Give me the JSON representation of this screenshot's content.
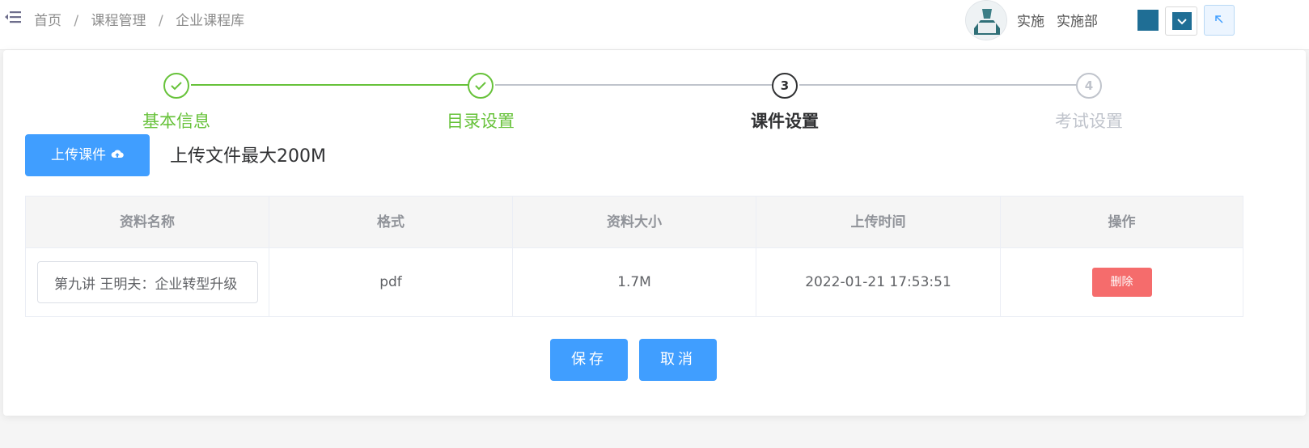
{
  "breadcrumb": {
    "items": [
      "首页",
      "课程管理",
      "企业课程库"
    ],
    "separator": "/"
  },
  "user": {
    "name": "实施",
    "department": "实施部"
  },
  "icons": {
    "menu": "menu-fold-icon",
    "avatar": "user-avatar",
    "fullscreen": "arrow-up-left-icon",
    "upload": "cloud-upload-icon",
    "check": "check-icon",
    "dropdown": "chevron-down-icon"
  },
  "colors": {
    "primary": "#409eff",
    "success": "#67c23a",
    "danger": "#f56c6c",
    "theme": "#1f6e95"
  },
  "steps": [
    {
      "number": "1",
      "title": "基本信息",
      "status": "done"
    },
    {
      "number": "2",
      "title": "目录设置",
      "status": "done"
    },
    {
      "number": "3",
      "title": "课件设置",
      "status": "active"
    },
    {
      "number": "4",
      "title": "考试设置",
      "status": "wait"
    }
  ],
  "upload": {
    "button_label": "上传课件",
    "hint": "上传文件最大200M"
  },
  "table": {
    "headers": [
      "资料名称",
      "格式",
      "资料大小",
      "上传时间",
      "操作"
    ],
    "rows": [
      {
        "name": "第九讲 王明夫：企业转型升级",
        "format": "pdf",
        "size": "1.7M",
        "uploaded": "2022-01-21 17:53:51",
        "action": "删除"
      }
    ]
  },
  "footer": {
    "save_label": "保存",
    "cancel_label": "取消"
  }
}
